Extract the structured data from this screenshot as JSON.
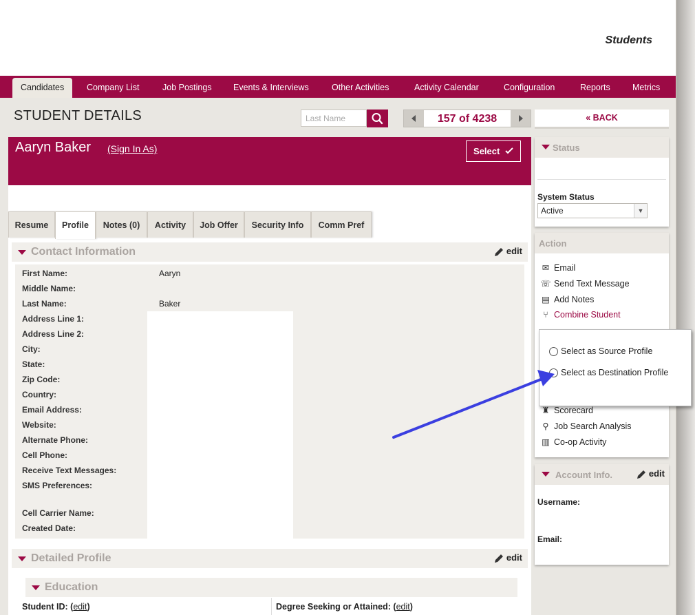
{
  "header": {
    "brand": "Students"
  },
  "nav": {
    "items": [
      {
        "label": "Candidates"
      },
      {
        "label": "Company List"
      },
      {
        "label": "Job Postings"
      },
      {
        "label": "Events & Interviews"
      },
      {
        "label": "Other Activities"
      },
      {
        "label": "Activity Calendar"
      },
      {
        "label": "Configuration"
      },
      {
        "label": "Reports"
      },
      {
        "label": "Metrics"
      }
    ]
  },
  "page": {
    "title": "STUDENT DETAILS",
    "search_placeholder": "Last Name",
    "pager": "157 of 4238",
    "back": "« BACK"
  },
  "student": {
    "name": "Aaryn Baker",
    "sign_in": "(Sign In As)",
    "select": "Select"
  },
  "tabs": [
    {
      "label": "Resume"
    },
    {
      "label": "Profile"
    },
    {
      "label": "Notes (0)"
    },
    {
      "label": "Activity"
    },
    {
      "label": "Job Offer"
    },
    {
      "label": "Security Info"
    },
    {
      "label": "Comm Pref"
    }
  ],
  "contact": {
    "title": "Contact Information",
    "edit": "edit",
    "fields": [
      {
        "label": "First Name:",
        "value": "Aaryn"
      },
      {
        "label": "Middle Name:",
        "value": ""
      },
      {
        "label": "Last Name:",
        "value": "Baker"
      },
      {
        "label": "Address Line 1:",
        "value": ""
      },
      {
        "label": "Address Line 2:",
        "value": ""
      },
      {
        "label": "City:",
        "value": ""
      },
      {
        "label": "State:",
        "value": ""
      },
      {
        "label": "Zip Code:",
        "value": ""
      },
      {
        "label": "Country:",
        "value": ""
      },
      {
        "label": "Email Address:",
        "value": ""
      },
      {
        "label": "Website:",
        "value": ""
      },
      {
        "label": "Alternate Phone:",
        "value": ""
      },
      {
        "label": "Cell Phone:",
        "value": ""
      },
      {
        "label": "Receive Text Messages:",
        "value": ""
      },
      {
        "label": "SMS Preferences:",
        "value": ""
      },
      {
        "label": "Cell Carrier Name:",
        "value": ""
      },
      {
        "label": "Created Date:",
        "value": ""
      }
    ]
  },
  "detailed": {
    "title": "Detailed Profile",
    "edit": "edit"
  },
  "education": {
    "title": "Education",
    "student_id_label": "Student ID:",
    "degree_label": "Degree Seeking or Attained:",
    "edit_link": "edit"
  },
  "status": {
    "title": "Status",
    "system_status_label": "System Status",
    "system_status_value": "Active"
  },
  "action": {
    "title": "Action",
    "items": [
      {
        "label": "Email",
        "icon": "envelope-icon"
      },
      {
        "label": "Send Text Message",
        "icon": "phone-icon"
      },
      {
        "label": "Add Notes",
        "icon": "notes-icon"
      },
      {
        "label": "Combine Student",
        "icon": "merge-icon"
      },
      {
        "label": "Scorecard",
        "icon": "trophy-icon"
      },
      {
        "label": "Job Search Analysis",
        "icon": "magnifier-icon"
      },
      {
        "label": "Co-op Activity",
        "icon": "building-icon"
      }
    ]
  },
  "popup": {
    "source": "Select as Source Profile",
    "destination": "Select as Destination Profile"
  },
  "account": {
    "title": "Account Info.",
    "edit": "edit",
    "username_label": "Username:",
    "email_label": "Email:"
  },
  "colors": {
    "brand": "#9c0a45",
    "annotation": "#3b3fe0"
  }
}
